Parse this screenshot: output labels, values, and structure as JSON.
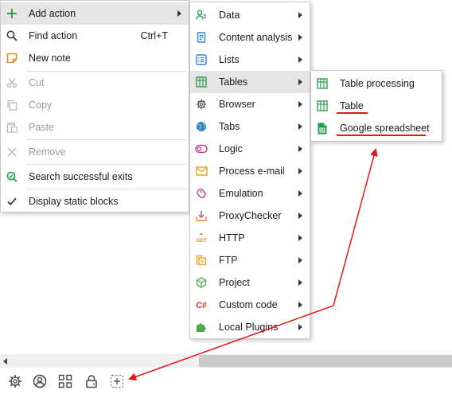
{
  "main_menu": {
    "items": [
      {
        "label": "Add action",
        "icon": "plus-icon",
        "has_submenu": true,
        "highlighted": true
      },
      {
        "label": "Find action",
        "shortcut": "Ctrl+T",
        "icon": "search-icon"
      },
      {
        "label": "New note",
        "icon": "note-icon"
      },
      {
        "label": "Cut",
        "icon": "scissors-icon",
        "disabled": true
      },
      {
        "label": "Copy",
        "icon": "copy-icon",
        "disabled": true
      },
      {
        "label": "Paste",
        "icon": "paste-icon",
        "disabled": true
      },
      {
        "label": "Remove",
        "icon": "close-icon",
        "disabled": true
      },
      {
        "label": "Search successful exits",
        "icon": "search-check-icon"
      },
      {
        "label": "Display static blocks",
        "icon": "checkmark-icon"
      }
    ]
  },
  "action_submenu": {
    "items": [
      {
        "label": "Data",
        "icon": "data-icon"
      },
      {
        "label": "Content analysis",
        "icon": "content-analysis-icon"
      },
      {
        "label": "Lists",
        "icon": "list-icon"
      },
      {
        "label": "Tables",
        "icon": "table-icon",
        "highlighted": true
      },
      {
        "label": "Browser",
        "icon": "browser-gear-icon"
      },
      {
        "label": "Tabs",
        "icon": "globe-icon"
      },
      {
        "label": "Logic",
        "icon": "logic-toggle-icon"
      },
      {
        "label": "Process e-mail",
        "icon": "email-icon"
      },
      {
        "label": "Emulation",
        "icon": "mouse-icon"
      },
      {
        "label": "ProxyChecker",
        "icon": "proxy-download-icon"
      },
      {
        "label": "HTTP",
        "icon": "http-get-icon",
        "icon_text": "GET"
      },
      {
        "label": "FTP",
        "icon": "ftp-icon"
      },
      {
        "label": "Project",
        "icon": "cube-icon"
      },
      {
        "label": "Custom code",
        "icon": "csharp-icon",
        "icon_text": "C#"
      },
      {
        "label": "Local Plugins",
        "icon": "puzzle-icon"
      }
    ]
  },
  "tables_submenu": {
    "items": [
      {
        "label": "Table processing",
        "icon": "table-icon"
      },
      {
        "label": "Table",
        "icon": "table-icon",
        "underlined": true
      },
      {
        "label": "Google spreadsheet",
        "icon": "google-sheets-icon",
        "underlined": true
      }
    ]
  },
  "bottom_toolbar": {
    "buttons": [
      {
        "name": "settings-button",
        "icon": "gear-icon"
      },
      {
        "name": "profile-button",
        "icon": "user-circle-icon"
      },
      {
        "name": "apps-button",
        "icon": "grid-icon"
      },
      {
        "name": "lock-button",
        "icon": "lock-icon"
      },
      {
        "name": "add-block-button",
        "icon": "dashed-plus-icon"
      }
    ]
  },
  "colors": {
    "menu_highlight": "#e5e5e5",
    "annotation_red": "#e01818",
    "green_icon": "#2e9e50",
    "blue_icon": "#2f7ed8",
    "orange_icon": "#f0a020",
    "magenta_icon": "#c83a8e"
  }
}
